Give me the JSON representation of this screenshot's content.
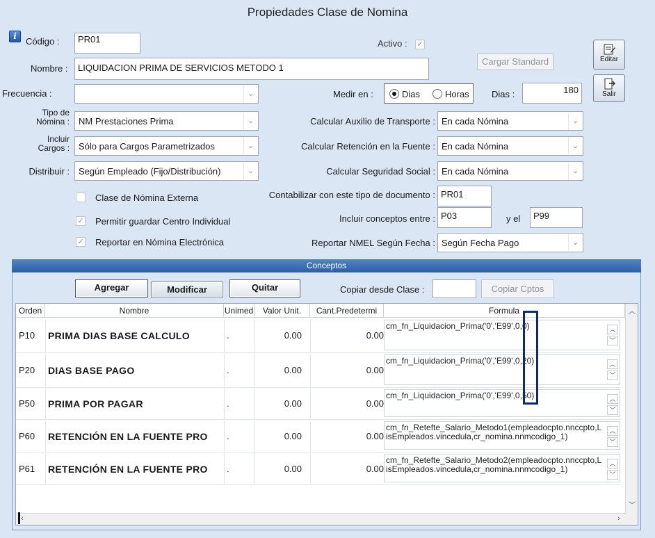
{
  "window": {
    "title": "Propiedades Clase de Nomina"
  },
  "form": {
    "codigo_label": "Código :",
    "codigo_value": "PR01",
    "activo_label": "Activo :",
    "activo_check": "✓",
    "nombre_label": "Nombre :",
    "nombre_value": "LIQUIDACION PRIMA DE SERVICIOS METODO 1",
    "cargar_standard": "Cargar Standard",
    "frecuencia_label": "Frecuencia :",
    "frecuencia_value": "",
    "medir_label": "Medir en :",
    "medir_options": [
      "Dias",
      "Horas"
    ],
    "dias_label": "Dias :",
    "dias_value": "180",
    "tipo_label_1": "Tipo de",
    "tipo_label_2": "Nómina :",
    "tipo_value": "NM Prestaciones Prima",
    "incluir_label_1": "Incluir",
    "incluir_label_2": "Cargos :",
    "incluir_value": "Sólo para Cargos Parametrizados",
    "distribuir_label": "Distribuir :",
    "distribuir_value": "Según Empleado (Fijo/Distribución)",
    "aux_transporte_label": "Calcular Auxilio de Transporte :",
    "aux_transporte_value": "En cada Nómina",
    "retencion_label": "Calcular Retención en la Fuente :",
    "retencion_value": "En cada Nómina",
    "seguridad_label": "Calcular Seguridad Social :",
    "seguridad_value": "En cada Nómina",
    "externa_label": "Clase de Nómina Externa",
    "permitir_label": "Permitir guardar Centro Individual",
    "reportar_label": "Reportar en Nómina Electrónica",
    "check_mark": "✓",
    "contabilizar_label": "Contabilizar con este tipo de documento :",
    "contabilizar_value": "PR01",
    "incluir_conceptos_label": "Incluir conceptos entre :",
    "concepto_desde": "P03",
    "y_el_label": "y el",
    "concepto_hasta": "P99",
    "nmel_label": "Reportar NMEL Según Fecha :",
    "nmel_value": "Según Fecha Pago",
    "chevron": "⌄"
  },
  "side_buttons": {
    "editar": "Editar",
    "salir": "Salir"
  },
  "conceptos": {
    "title": "Conceptos",
    "agregar": "Agregar",
    "modificar": "Modificar",
    "quitar": "Quitar",
    "copiar_label": "Copiar desde Clase :",
    "copiar_value": "",
    "copiar_btn": "Copiar Cptos",
    "columns": [
      "Orden",
      "Nombre",
      "Unimed",
      "Valor Unit.",
      "Cant.Predetermi",
      "Formula"
    ],
    "rows": [
      {
        "orden": "P10",
        "nombre": "PRIMA DIAS BASE CALCULO",
        "unimed": ".",
        "valor": "0.00",
        "cant": "0.00",
        "formula": "cm_fn_Liquidacion_Prima('0','E99',0,0)"
      },
      {
        "orden": "P20",
        "nombre": "DIAS BASE PAGO",
        "unimed": ".",
        "valor": "0.00",
        "cant": "0.00",
        "formula": "cm_fn_Liquidacion_Prima('0','E99',0,20)"
      },
      {
        "orden": "P50",
        "nombre": "PRIMA POR PAGAR",
        "unimed": ".",
        "valor": "0.00",
        "cant": "0.00",
        "formula": "cm_fn_Liquidacion_Prima('0','E99',0,50)"
      },
      {
        "orden": "P60",
        "nombre": "RETENCIÓN EN LA FUENTE PRO",
        "unimed": ".",
        "valor": "0.00",
        "cant": "0.00",
        "formula": "cm_fn_Retefte_Salario_Metodo1(empleadocpto.nnccpto,LisEmpleados.vincedula,cr_nomina.nnmcodigo_1)"
      },
      {
        "orden": "P61",
        "nombre": "RETENCIÓN EN LA FUENTE PRO",
        "unimed": ".",
        "valor": "0.00",
        "cant": "0.00",
        "formula": "cm_fn_Retefte_Salario_Metodo2(empleadocpto.nnccpto,LisEmpleados.vincedula,cr_nomina.nnmcodigo_1)"
      }
    ]
  }
}
